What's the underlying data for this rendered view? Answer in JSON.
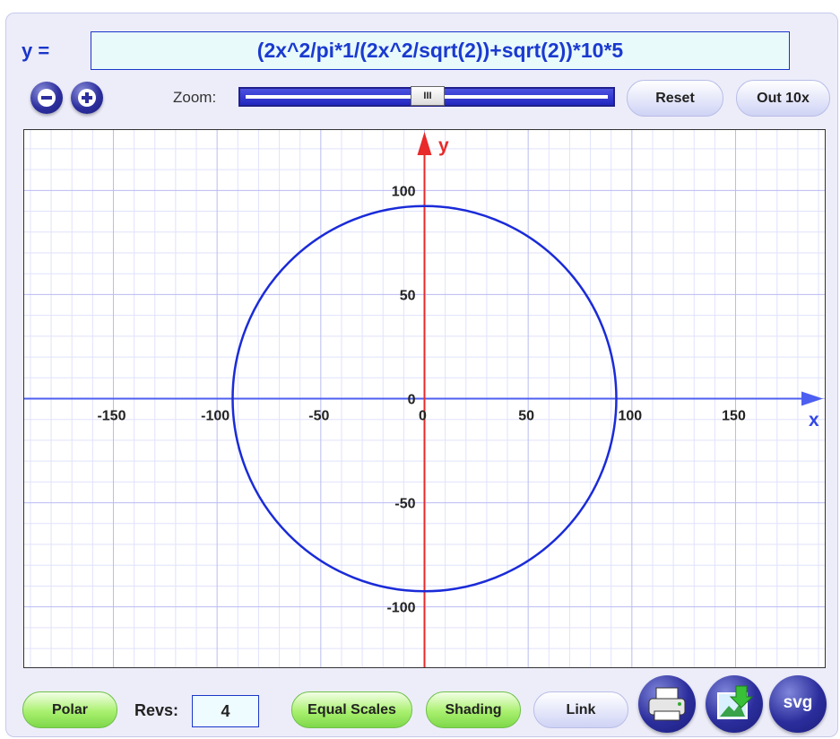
{
  "header": {
    "y_label": "y =",
    "formula": "(2x^2/pi*1/(2x^2/sqrt(2))+sqrt(2))*10*5"
  },
  "zoom": {
    "label": "Zoom:",
    "thumb_label": "III",
    "reset_label": "Reset",
    "out_label": "Out 10x"
  },
  "footer": {
    "polar_label": "Polar",
    "revs_label": "Revs:",
    "revs_value": "4",
    "equal_scales_label": "Equal Scales",
    "shading_label": "Shading",
    "link_label": "Link",
    "svg_label": "svg"
  },
  "colors": {
    "axis": "#e82a2a",
    "x_axis": "#4d5ff0",
    "curve": "#1a2bd8",
    "grid_major": "#b9bcf2",
    "grid_minor": "#e0e2fb"
  },
  "icons": [
    "zoom-out-icon",
    "zoom-in-icon",
    "print-icon",
    "save-image-icon",
    "svg-export-icon"
  ],
  "chart_data": {
    "type": "line",
    "title": "",
    "xlabel": "x",
    "ylabel": "y",
    "xlim": [
      -193,
      193
    ],
    "ylim": [
      -129,
      129
    ],
    "x_ticks": [
      -150,
      -100,
      -50,
      0,
      50,
      100,
      150
    ],
    "y_ticks": [
      -100,
      -50,
      0,
      50,
      100
    ],
    "grid": true,
    "series": [
      {
        "shape": "circle",
        "center": [
          0,
          0
        ],
        "radius": 92.5
      }
    ]
  }
}
